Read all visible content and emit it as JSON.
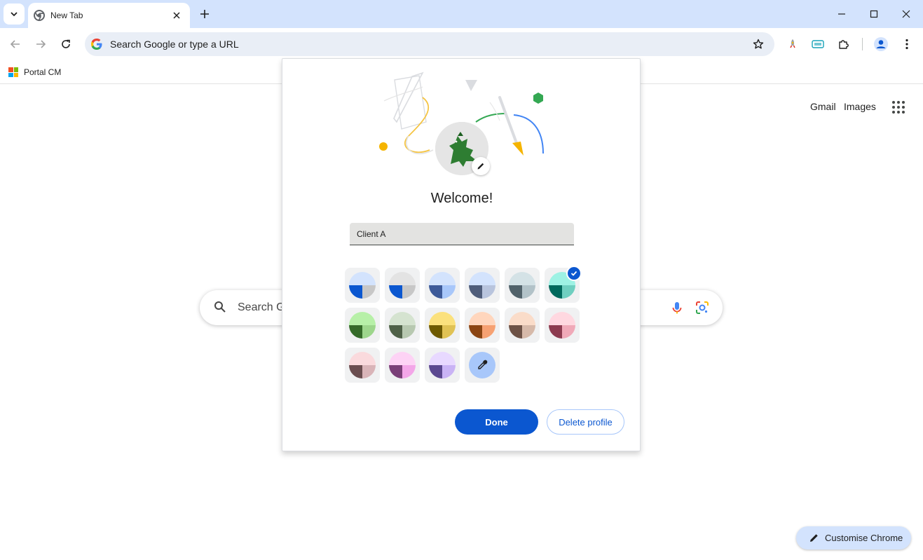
{
  "tab": {
    "title": "New Tab",
    "icons": {
      "favicon": "chrome-icon",
      "close": "close-icon"
    }
  },
  "window": {
    "icons": [
      "minimize-icon",
      "maximize-icon",
      "close-icon"
    ]
  },
  "toolbar": {
    "omnibox_placeholder": "Search Google or type a URL",
    "icons": [
      "back-icon",
      "forward-icon",
      "reload-icon",
      "google-icon",
      "star-icon",
      "extension-rocket-icon",
      "extension-bar-icon",
      "puzzle-icon",
      "profile-icon",
      "more-icon"
    ]
  },
  "bookmarks": [
    {
      "label": "Portal CM",
      "icon": "microsoft-logo-icon"
    }
  ],
  "ntp": {
    "links": [
      "Gmail",
      "Images"
    ],
    "search_text": "Search Go",
    "customise_label": "Customise Chrome"
  },
  "dialog": {
    "welcome": "Welcome!",
    "name_value": "Client A",
    "done_label": "Done",
    "delete_label": "Delete profile",
    "selected_index": 5,
    "themes": [
      {
        "top": "#d3e3fd",
        "bl": "#0b57d0",
        "br": "#c7c7c7"
      },
      {
        "top": "#e3e3e3",
        "bl": "#0b57d0",
        "br": "#c7c7c7"
      },
      {
        "top": "#d3e3fd",
        "bl": "#3d5a99",
        "br": "#a8c7fa"
      },
      {
        "top": "#d3e3fd",
        "bl": "#4f5d7a",
        "br": "#b8c4dd"
      },
      {
        "top": "#d4e2e6",
        "bl": "#51626a",
        "br": "#b2c2c8"
      },
      {
        "top": "#9ef2e4",
        "bl": "#00695c",
        "br": "#6fcfc0"
      },
      {
        "top": "#b7f0a8",
        "bl": "#356b29",
        "br": "#9dd68c"
      },
      {
        "top": "#d5e3d0",
        "bl": "#4f6148",
        "br": "#b7c8b0"
      },
      {
        "top": "#fbe17d",
        "bl": "#6e5a00",
        "br": "#e0c254"
      },
      {
        "top": "#ffd6bd",
        "bl": "#8b4513",
        "br": "#f6a172"
      },
      {
        "top": "#fadcc9",
        "bl": "#6d5246",
        "br": "#d6b9a9"
      },
      {
        "top": "#ffd8e0",
        "bl": "#8c3b4f",
        "br": "#f0a9b8"
      },
      {
        "top": "#fadadd",
        "bl": "#6a4d4f",
        "br": "#d9b4b8"
      },
      {
        "top": "#fdd3f5",
        "bl": "#7a3f78",
        "br": "#f3a6e8"
      },
      {
        "top": "#e8d9ff",
        "bl": "#5b4890",
        "br": "#c9b3f5"
      }
    ],
    "picker_icon": "eyedropper-icon"
  },
  "colors": {
    "accent": "#0b57d0",
    "tabstrip": "#d3e3fd",
    "omnibox": "#e9eef6"
  }
}
